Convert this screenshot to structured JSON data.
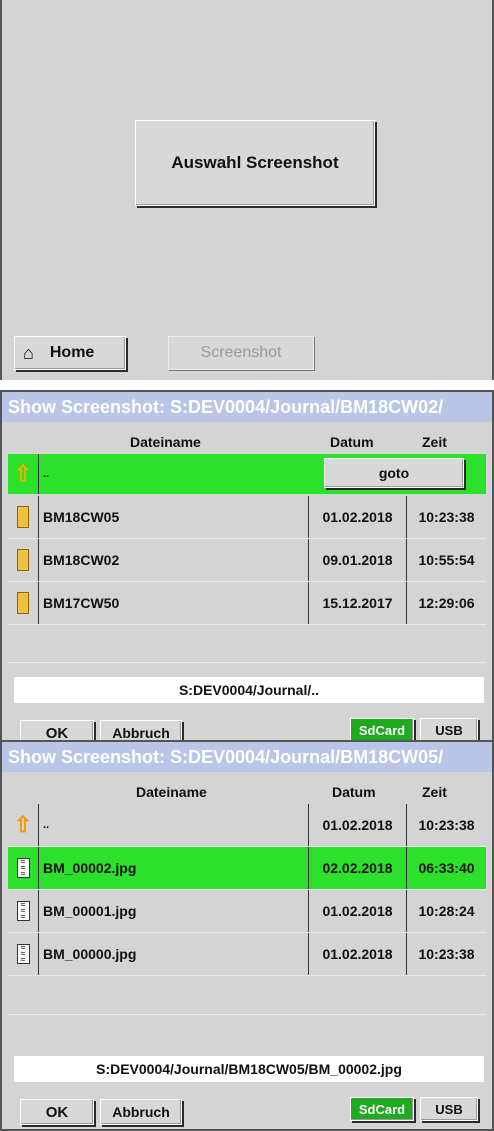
{
  "panel1": {
    "select_button": "Auswahl Screenshot",
    "home_button": "Home",
    "screenshot_button": "Screenshot"
  },
  "panel2": {
    "title": "Show Screenshot:  S:DEV0004/Journal/BM18CW02/",
    "columns": {
      "name": "Dateiname",
      "date": "Datum",
      "time": "Zeit"
    },
    "rows": [
      {
        "icon": "up-arrow-icon",
        "name": "..",
        "goto": "goto"
      },
      {
        "icon": "folder-icon",
        "name": "BM18CW05",
        "date": "01.02.2018",
        "time": "10:23:38"
      },
      {
        "icon": "folder-icon",
        "name": "BM18CW02",
        "date": "09.01.2018",
        "time": "10:55:54"
      },
      {
        "icon": "folder-icon",
        "name": "BM17CW50",
        "date": "15.12.2017",
        "time": "12:29:06"
      }
    ],
    "path": "S:DEV0004/Journal/..",
    "ok": "OK",
    "cancel": "Abbruch",
    "sdcard": "SdCard",
    "usb": "USB"
  },
  "panel3": {
    "title": "Show Screenshot:  S:DEV0004/Journal/BM18CW05/",
    "columns": {
      "name": "Dateiname",
      "date": "Datum",
      "time": "Zeit"
    },
    "rows": [
      {
        "icon": "up-arrow-icon",
        "name": "..",
        "date": "01.02.2018",
        "time": "10:23:38"
      },
      {
        "icon": "image-file-icon",
        "name": "BM_00002.jpg",
        "date": "02.02.2018",
        "time": "06:33:40"
      },
      {
        "icon": "image-file-icon",
        "name": "BM_00001.jpg",
        "date": "01.02.2018",
        "time": "10:28:24"
      },
      {
        "icon": "image-file-icon",
        "name": "BM_00000.jpg",
        "date": "01.02.2018",
        "time": "10:23:38"
      }
    ],
    "path": "S:DEV0004/Journal/BM18CW05/BM_00002.jpg",
    "ok": "OK",
    "cancel": "Abbruch",
    "sdcard": "SdCard",
    "usb": "USB"
  },
  "colors": {
    "selection": "#2be12b",
    "titlebar": "#b9c6e8",
    "active_storage": "#1faa1f"
  }
}
